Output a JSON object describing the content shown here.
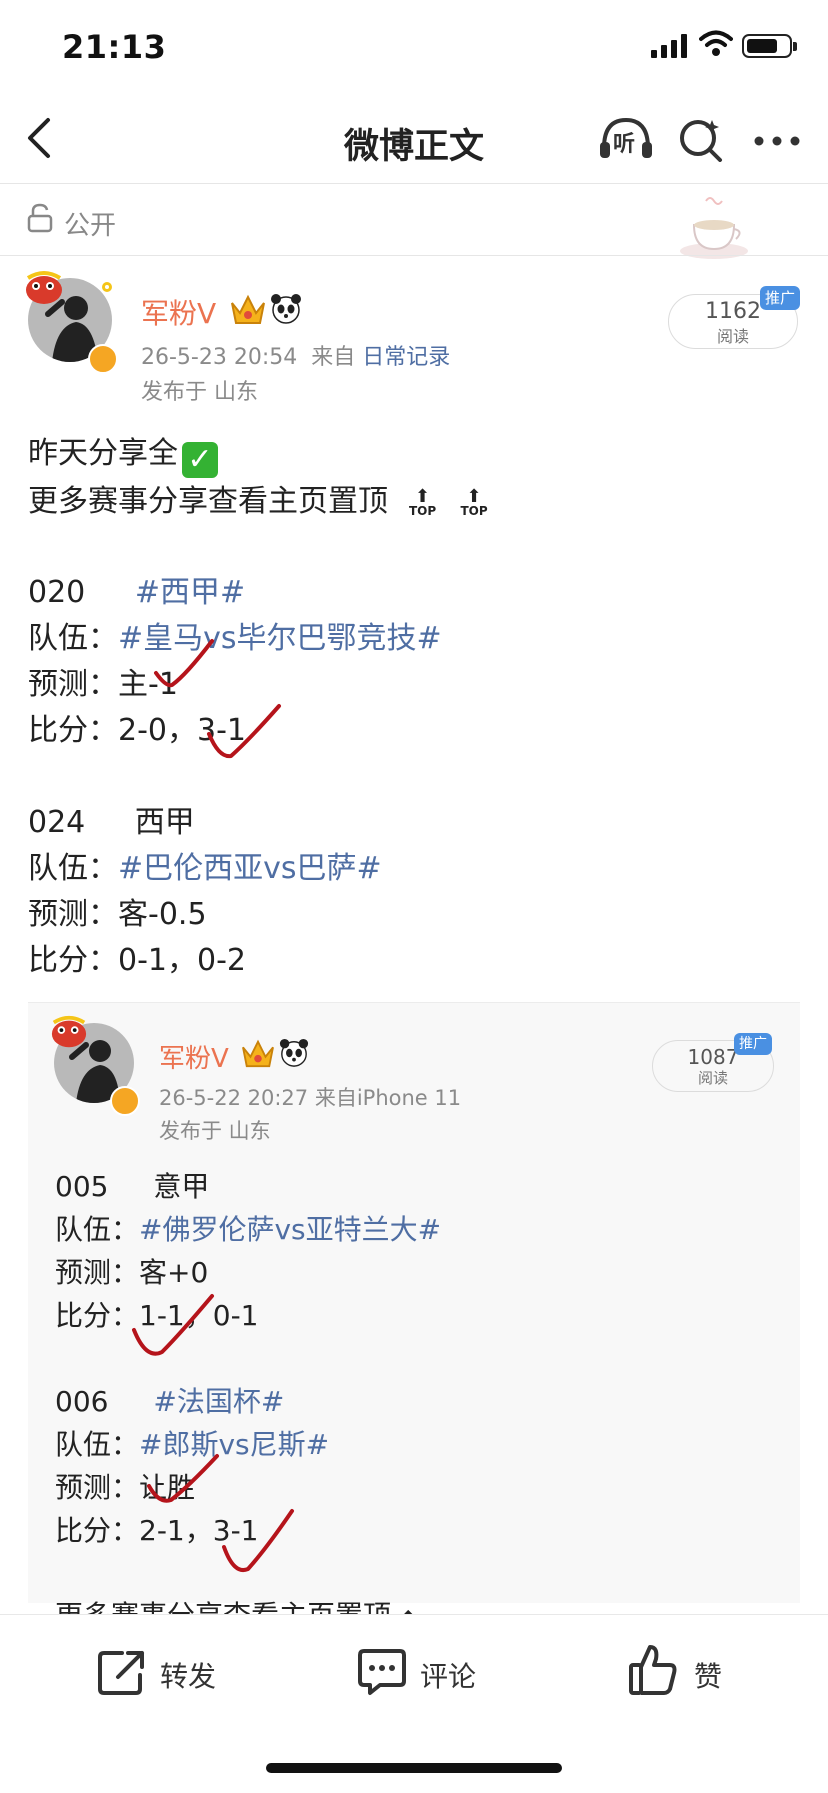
{
  "status_bar": {
    "time": "21:13"
  },
  "nav": {
    "title": "微博正文",
    "listen_label": "听"
  },
  "visibility": {
    "label": "公开"
  },
  "post": {
    "username": "军粉V",
    "meta_date": "26-5-23 20:54",
    "meta_from": "来自",
    "meta_source": "日常记录",
    "location": "发布于 山东",
    "read_count": "1162",
    "read_label": "阅读",
    "promo_label": "推广",
    "intro_line1": "昨天分享全",
    "intro_line2": "更多赛事分享查看主页置顶",
    "top_label": "TOP",
    "matches": [
      {
        "code": "020",
        "league": "#西甲#",
        "team_prefix": "队伍：",
        "teams": "#皇马vs毕尔巴鄂竞技#",
        "pred_prefix": "预测：",
        "prediction": "主-1",
        "score_prefix": "比分：",
        "score": "2-0，3-1"
      },
      {
        "code": "024",
        "league": "西甲",
        "team_prefix": "队伍：",
        "teams": "#巴伦西亚vs巴萨#",
        "pred_prefix": "预测：",
        "prediction": "客-0.5",
        "score_prefix": "比分：",
        "score": "0-1，0-2"
      }
    ]
  },
  "repost": {
    "username": "军粉V",
    "meta": "26-5-22 20:27  来自iPhone 11",
    "location": "发布于 山东",
    "read_count": "1087",
    "read_label": "阅读",
    "promo_label": "推广",
    "matches": [
      {
        "code": "005",
        "league": "意甲",
        "team_prefix": "队伍：",
        "teams": "#佛罗伦萨vs亚特兰大#",
        "pred_prefix": "预测：",
        "prediction": "客+0",
        "score_prefix": "比分：",
        "score": "1-1，0-1"
      },
      {
        "code": "006",
        "league": "#法国杯#",
        "team_prefix": "队伍：",
        "teams": "#郎斯vs尼斯#",
        "pred_prefix": "预测：",
        "prediction": "让胜",
        "score_prefix": "比分：",
        "score": "2-1，3-1"
      }
    ],
    "footer_text": "更多赛事分享查看主页置顶"
  },
  "actions": {
    "repost": "转发",
    "comment": "评论",
    "like": "赞"
  },
  "colors": {
    "username": "#eb7350",
    "link": "#4f6ea3",
    "promo": "#4a90e2",
    "check_mark": "#b5141b"
  }
}
